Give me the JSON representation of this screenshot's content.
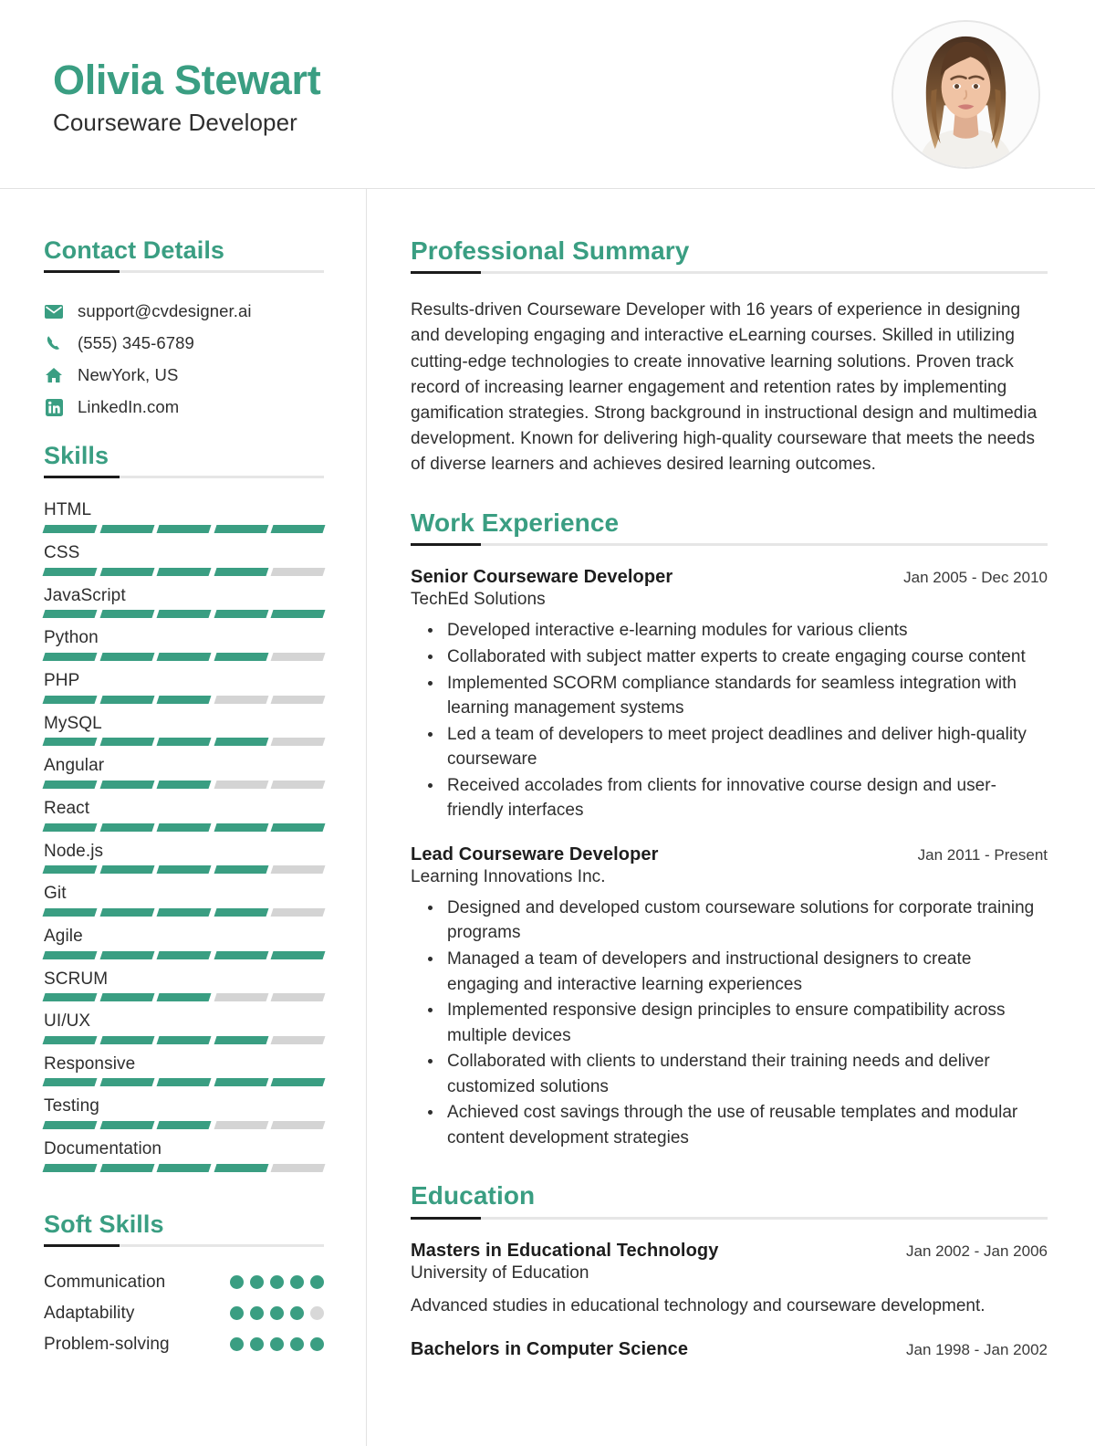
{
  "theme": {
    "accent": "#3a9e82",
    "rule_dark": "#1b1b1b",
    "rule_light": "#e6e6e6",
    "text": "#2e2e2e"
  },
  "header": {
    "name": "Olivia Stewart",
    "title": "Courseware Developer",
    "avatar_alt": "profile-photo"
  },
  "sidebar": {
    "contact": {
      "heading": "Contact Details",
      "items": [
        {
          "icon": "envelope-icon",
          "value": "support@cvdesigner.ai"
        },
        {
          "icon": "phone-icon",
          "value": "(555) 345-6789"
        },
        {
          "icon": "home-icon",
          "value": "NewYork, US"
        },
        {
          "icon": "linkedin-icon",
          "value": "LinkedIn.com"
        }
      ]
    },
    "skills": {
      "heading": "Skills",
      "max": 5,
      "items": [
        {
          "name": "HTML",
          "level": 5
        },
        {
          "name": "CSS",
          "level": 4
        },
        {
          "name": "JavaScript",
          "level": 5
        },
        {
          "name": "Python",
          "level": 4
        },
        {
          "name": "PHP",
          "level": 3
        },
        {
          "name": "MySQL",
          "level": 4
        },
        {
          "name": "Angular",
          "level": 3
        },
        {
          "name": "React",
          "level": 5
        },
        {
          "name": "Node.js",
          "level": 4
        },
        {
          "name": "Git",
          "level": 4
        },
        {
          "name": "Agile",
          "level": 5
        },
        {
          "name": "SCRUM",
          "level": 3
        },
        {
          "name": "UI/UX",
          "level": 4
        },
        {
          "name": "Responsive",
          "level": 5
        },
        {
          "name": "Testing",
          "level": 3
        },
        {
          "name": "Documentation",
          "level": 4
        }
      ]
    },
    "soft_skills": {
      "heading": "Soft Skills",
      "max": 5,
      "items": [
        {
          "name": "Communication",
          "level": 5
        },
        {
          "name": "Adaptability",
          "level": 4
        },
        {
          "name": "Problem-solving",
          "level": 5
        }
      ]
    }
  },
  "main": {
    "summary": {
      "heading": "Professional Summary",
      "text": "Results-driven Courseware Developer with 16 years of experience in designing and developing engaging and interactive eLearning courses. Skilled in utilizing cutting-edge technologies to create innovative learning solutions. Proven track record of increasing learner engagement and retention rates by implementing gamification strategies. Strong background in instructional design and multimedia development. Known for delivering high-quality courseware that meets the needs of diverse learners and achieves desired learning outcomes."
    },
    "work": {
      "heading": "Work Experience",
      "entries": [
        {
          "title": "Senior Courseware Developer",
          "date": "Jan 2005 - Dec 2010",
          "org": "TechEd Solutions",
          "bullets": [
            "Developed interactive e-learning modules for various clients",
            "Collaborated with subject matter experts to create engaging course content",
            "Implemented SCORM compliance standards for seamless integration with learning management systems",
            "Led a team of developers to meet project deadlines and deliver high-quality courseware",
            "Received accolades from clients for innovative course design and user-friendly interfaces"
          ]
        },
        {
          "title": "Lead Courseware Developer",
          "date": "Jan 2011 - Present",
          "org": "Learning Innovations Inc.",
          "bullets": [
            "Designed and developed custom courseware solutions for corporate training programs",
            "Managed a team of developers and instructional designers to create engaging and interactive learning experiences",
            "Implemented responsive design principles to ensure compatibility across multiple devices",
            "Collaborated with clients to understand their training needs and deliver customized solutions",
            "Achieved cost savings through the use of reusable templates and modular content development strategies"
          ]
        }
      ]
    },
    "education": {
      "heading": "Education",
      "entries": [
        {
          "title": "Masters in Educational Technology",
          "date": "Jan 2002 - Jan 2006",
          "org": "University of Education",
          "desc": "Advanced studies in educational technology and courseware development."
        },
        {
          "title": "Bachelors in Computer Science",
          "date": "Jan 1998 - Jan 2002",
          "org": "",
          "desc": ""
        }
      ]
    }
  }
}
